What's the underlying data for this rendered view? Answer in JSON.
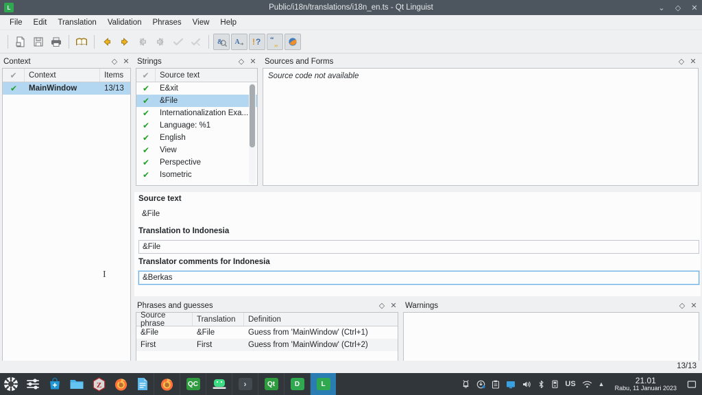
{
  "window": {
    "title": "Public/i18n/translations/i18n_en.ts - Qt Linguist",
    "app_icon_letter": "L",
    "controls": {
      "minimize": "⌄",
      "maximize": "◇",
      "close": "✕"
    }
  },
  "menubar": {
    "items": [
      {
        "label": "File"
      },
      {
        "label": "Edit"
      },
      {
        "label": "Translation"
      },
      {
        "label": "Validation"
      },
      {
        "label": "Phrases"
      },
      {
        "label": "View"
      },
      {
        "label": "Help"
      }
    ]
  },
  "toolbar": {
    "groups": [
      {
        "buttons": [
          {
            "name": "open-icon",
            "checked": false
          },
          {
            "name": "save-icon",
            "checked": false
          },
          {
            "name": "print-icon",
            "checked": false
          }
        ]
      },
      {
        "buttons": [
          {
            "name": "open-phrase-book-icon",
            "checked": false
          }
        ]
      },
      {
        "buttons": [
          {
            "name": "prev-icon",
            "checked": false
          },
          {
            "name": "next-icon",
            "checked": false
          },
          {
            "name": "prev-unfinished-icon",
            "checked": false
          },
          {
            "name": "next-unfinished-icon",
            "checked": false
          },
          {
            "name": "done-and-next-icon",
            "checked": false
          },
          {
            "name": "accelerator-icon",
            "checked": false
          }
        ]
      },
      {
        "buttons": [
          {
            "name": "validate-accelerators-icon",
            "checked": true
          },
          {
            "name": "validate-surrounding-whitespace-icon",
            "checked": true
          },
          {
            "name": "validate-ending-punctuation-icon",
            "checked": true
          },
          {
            "name": "validate-phrase-matches-icon",
            "checked": true
          },
          {
            "name": "validate-place-markers-icon",
            "checked": true
          }
        ]
      }
    ]
  },
  "context_panel": {
    "title": "Context",
    "float_btn": "◇",
    "close_btn": "✕",
    "columns": [
      "",
      "Context",
      "Items"
    ],
    "rows": [
      {
        "status": "✔",
        "context": "MainWindow",
        "items": "13/13",
        "selected": true
      }
    ]
  },
  "strings_panel": {
    "title": "Strings",
    "float_btn": "◇",
    "close_btn": "✕",
    "columns": [
      "",
      "Source text"
    ],
    "rows": [
      {
        "status": "✔",
        "source": "E&xit",
        "selected": false
      },
      {
        "status": "✔",
        "source": "&File",
        "selected": true
      },
      {
        "status": "✔",
        "source": "Internationalization Exa...",
        "selected": false
      },
      {
        "status": "✔",
        "source": "Language: %1",
        "selected": false
      },
      {
        "status": "✔",
        "source": "English",
        "selected": false
      },
      {
        "status": "✔",
        "source": "View",
        "selected": false
      },
      {
        "status": "✔",
        "source": "Perspective",
        "selected": false
      },
      {
        "status": "✔",
        "source": "Isometric",
        "selected": false
      }
    ]
  },
  "sources_panel": {
    "title": "Sources and Forms",
    "float_btn": "◇",
    "close_btn": "✕",
    "message": "Source code not available"
  },
  "editor": {
    "source_label": "Source text",
    "source_value": "&File",
    "translation_label": "Translation to Indonesia",
    "translation_value": "&File",
    "comments_label": "Translator comments for Indonesia",
    "comments_value": "&Berkas"
  },
  "phrases_panel": {
    "title": "Phrases and guesses",
    "float_btn": "◇",
    "close_btn": "✕",
    "columns": [
      "Source phrase",
      "Translation",
      "Definition"
    ],
    "rows": [
      {
        "source": "&File",
        "translation": "&File",
        "definition": "Guess from 'MainWindow' (Ctrl+1)"
      },
      {
        "source": "First",
        "translation": "First",
        "definition": "Guess from 'MainWindow' (Ctrl+2)"
      }
    ]
  },
  "warnings_panel": {
    "title": "Warnings",
    "float_btn": "◇",
    "close_btn": "✕",
    "content": ""
  },
  "statusbar": {
    "count": "13/13"
  },
  "taskbar": {
    "launchers": [
      {
        "name": "app-menu-icon",
        "letter": ""
      },
      {
        "name": "settings-icon",
        "letter": ""
      },
      {
        "name": "software-store-icon",
        "letter": ""
      },
      {
        "name": "file-manager-icon",
        "letter": ""
      },
      {
        "name": "zotero-icon",
        "letter": "Z"
      },
      {
        "name": "firefox-icon",
        "letter": ""
      },
      {
        "name": "text-editor-icon",
        "letter": ""
      }
    ],
    "tasks": [
      {
        "name": "firefox-window",
        "letter": "",
        "active": false
      },
      {
        "name": "qt-creator-window",
        "letter": "QC",
        "active": false
      },
      {
        "name": "android-studio-window",
        "letter": "",
        "active": false
      },
      {
        "name": "terminal-window",
        "letter": "›",
        "active": false
      },
      {
        "name": "qt-designer-window",
        "letter": "Qt",
        "active": false
      },
      {
        "name": "designer-window",
        "letter": "D",
        "active": false
      },
      {
        "name": "qt-linguist-window",
        "letter": "L",
        "active": true
      }
    ],
    "tray": [
      {
        "name": "notifications-icon",
        "glyph": "⚲"
      },
      {
        "name": "updates-icon",
        "glyph": "⊕"
      },
      {
        "name": "clipboard-icon",
        "glyph": "▤"
      },
      {
        "name": "display-icon",
        "glyph": "▣"
      },
      {
        "name": "volume-icon",
        "glyph": "◀"
      },
      {
        "name": "bluetooth-icon",
        "glyph": "✱"
      },
      {
        "name": "removable-device-icon",
        "glyph": "▯"
      },
      {
        "name": "keyboard-layout",
        "glyph": "US"
      },
      {
        "name": "wifi-icon",
        "glyph": "◜"
      },
      {
        "name": "show-hidden-icon",
        "glyph": "▲"
      }
    ],
    "clock": {
      "time": "21.01",
      "date": "Rabu, 11 Januari 2023"
    },
    "show_desktop": {
      "name": "show-desktop-icon",
      "glyph": "▢"
    }
  }
}
